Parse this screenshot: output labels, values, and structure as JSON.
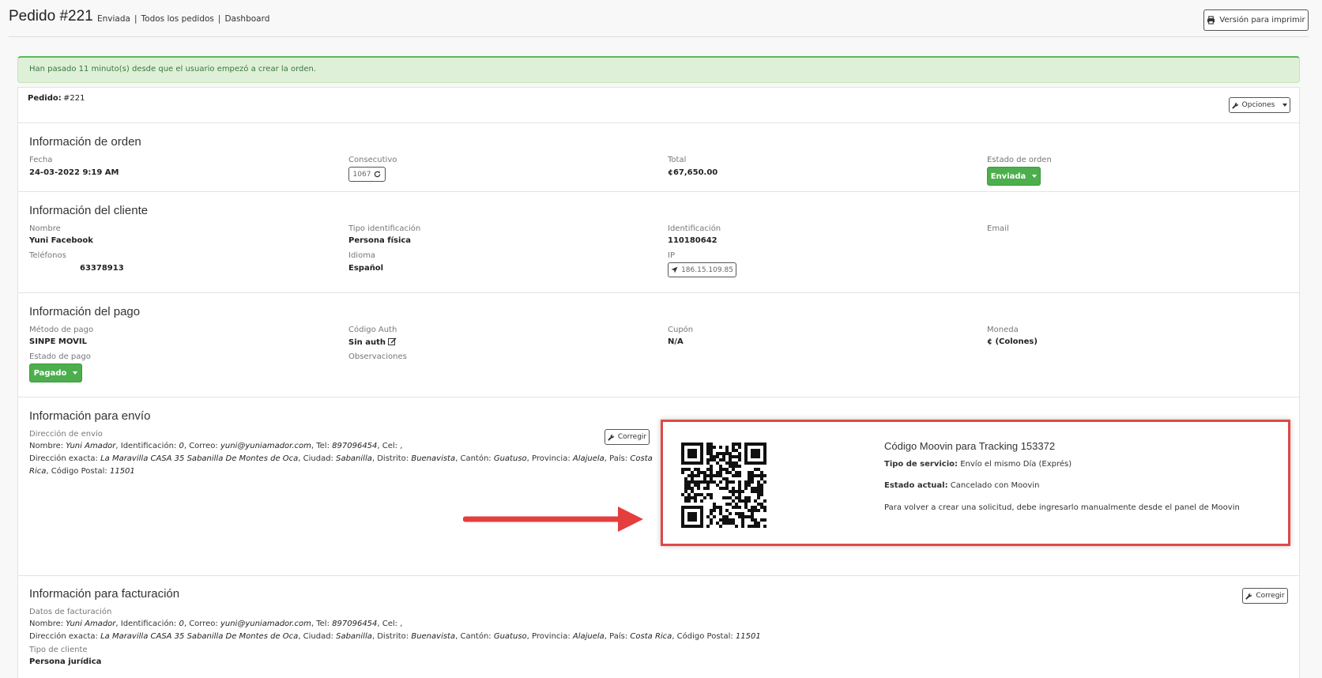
{
  "header": {
    "title": "Pedido #221",
    "status": "Enviada",
    "link_all": "Todos los pedidos",
    "link_dashboard": "Dashboard",
    "print_button": "Versión para imprimir"
  },
  "alert": "Han pasado 11 minuto(s) desde que el usuario empezó a crear la orden.",
  "order": {
    "pedido_label": "Pedido:",
    "pedido_value": "#221",
    "options_button": "Opciones"
  },
  "order_info": {
    "heading": "Información de orden",
    "fecha_label": "Fecha",
    "fecha_value": "24-03-2022 9:19 AM",
    "consecutivo_label": "Consecutivo",
    "consecutivo_value": "1067",
    "total_label": "Total",
    "total_value": "¢67,650.00",
    "estado_label": "Estado de orden",
    "estado_value": "Enviada"
  },
  "client_info": {
    "heading": "Información del cliente",
    "nombre_label": "Nombre",
    "nombre_value": "Yuni Facebook",
    "tipo_label": "Tipo identificación",
    "tipo_value": "Persona física",
    "ident_label": "Identificación",
    "ident_value": "110180642",
    "email_label": "Email",
    "tel_label": "Teléfonos",
    "tel_value": "63378913",
    "idioma_label": "Idioma",
    "idioma_value": "Español",
    "ip_label": "IP",
    "ip_value": "186.15.109.85"
  },
  "payment_info": {
    "heading": "Información del pago",
    "metodo_label": "Método de pago",
    "metodo_value": "SINPE MOVIL",
    "auth_label": "Código Auth",
    "auth_value": "Sin auth",
    "cupon_label": "Cupón",
    "cupon_value": "N/A",
    "moneda_label": "Moneda",
    "moneda_value": "¢ (Colones)",
    "estado_label": "Estado de pago",
    "estado_value": "Pagado",
    "obs_label": "Observaciones"
  },
  "shipping": {
    "heading": "Información para envío",
    "dir_label": "Dirección de envío",
    "fix_button": "Corregir",
    "line1": {
      "p1": "Nombre: ",
      "v1": "Yuni Amador",
      "p2": ", Identificación: ",
      "v2": "0",
      "p3": ", Correo: ",
      "v3": "yuni@yuniamador.com",
      "p4": ", Tel: ",
      "v4": "897096454",
      "p5": ", Cel: ,"
    },
    "line2": {
      "p1": "Dirección exacta: ",
      "v1": "La Maravilla CASA 35 Sabanilla De Montes de Oca",
      "p2": ", Ciudad: ",
      "v2": "Sabanilla",
      "p3": ", Distrito: ",
      "v3": "Buenavista",
      "p4": ", Cantón: ",
      "v4": "Guatuso",
      "p5": ", Provincia: ",
      "v5": "Alajuela",
      "p6": ", País: ",
      "v6": "Costa Rica",
      "p7": ", Código Postal: ",
      "v7": "11501"
    }
  },
  "moovin": {
    "title": "Código Moovin para Tracking 153372",
    "servicio_label": "Tipo de servicio:",
    "servicio_value": "Envío el mismo Día (Exprés)",
    "estado_label": "Estado actual:",
    "estado_value": "Cancelado con Moovin",
    "note": "Para volver a crear una solicitud, debe ingresarlo manualmente desde el panel de Moovin"
  },
  "billing": {
    "heading": "Información para facturación",
    "datos_label": "Datos de facturación",
    "fix_button": "Corregir",
    "line1": {
      "p1": "Nombre: ",
      "v1": "Yuni Amador",
      "p2": ", Identificación: ",
      "v2": "0",
      "p3": ", Correo: ",
      "v3": "yuni@yuniamador.com",
      "p4": ", Tel: ",
      "v4": "897096454",
      "p5": ", Cel: ,"
    },
    "line2": {
      "p1": "Dirección exacta: ",
      "v1": "La Maravilla CASA 35 Sabanilla De Montes de Oca",
      "p2": ", Ciudad: ",
      "v2": "Sabanilla",
      "p3": ", Distrito: ",
      "v3": "Buenavista",
      "p4": ", Cantón: ",
      "v4": "Guatuso",
      "p5": ", Provincia: ",
      "v5": "Alajuela",
      "p6": ", País: ",
      "v6": "Costa Rica",
      "p7": ", Código Postal: ",
      "v7": "11501"
    },
    "tipo_label": "Tipo de cliente",
    "tipo_value": "Persona jurídica"
  },
  "colors": {
    "success_green": "#4cae4c",
    "alert_bg": "#dff0d8",
    "highlight_red": "#e04848"
  },
  "icons": [
    "printer-icon",
    "wrench-icon",
    "refresh-icon",
    "location-arrow-icon",
    "edit-icon",
    "caret-down-icon",
    "qr-code-icon",
    "arrow-annotation-icon"
  ]
}
